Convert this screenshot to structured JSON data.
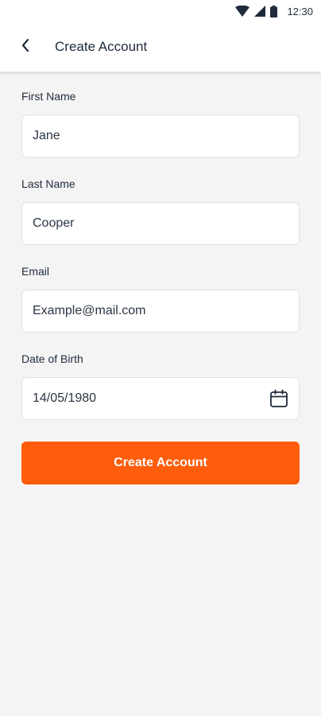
{
  "status_bar": {
    "time": "12:30",
    "icons": [
      "wifi-icon",
      "signal-icon",
      "battery-icon"
    ]
  },
  "app_bar": {
    "back_icon": "chevron-left-icon",
    "title": "Create Account"
  },
  "form": {
    "fields": [
      {
        "label": "First Name",
        "value": "Jane"
      },
      {
        "label": "Last Name",
        "value": "Cooper"
      },
      {
        "label": "Email",
        "value": "Example@mail.com"
      },
      {
        "label": "Date of Birth",
        "value": "14/05/1980",
        "icon": "calendar-icon"
      }
    ],
    "submit_label": "Create Account"
  },
  "colors": {
    "accent": "#ff5c0b",
    "background": "#f4f4f4",
    "text": "#1f2b3a",
    "field_border": "#dfe2e6"
  }
}
